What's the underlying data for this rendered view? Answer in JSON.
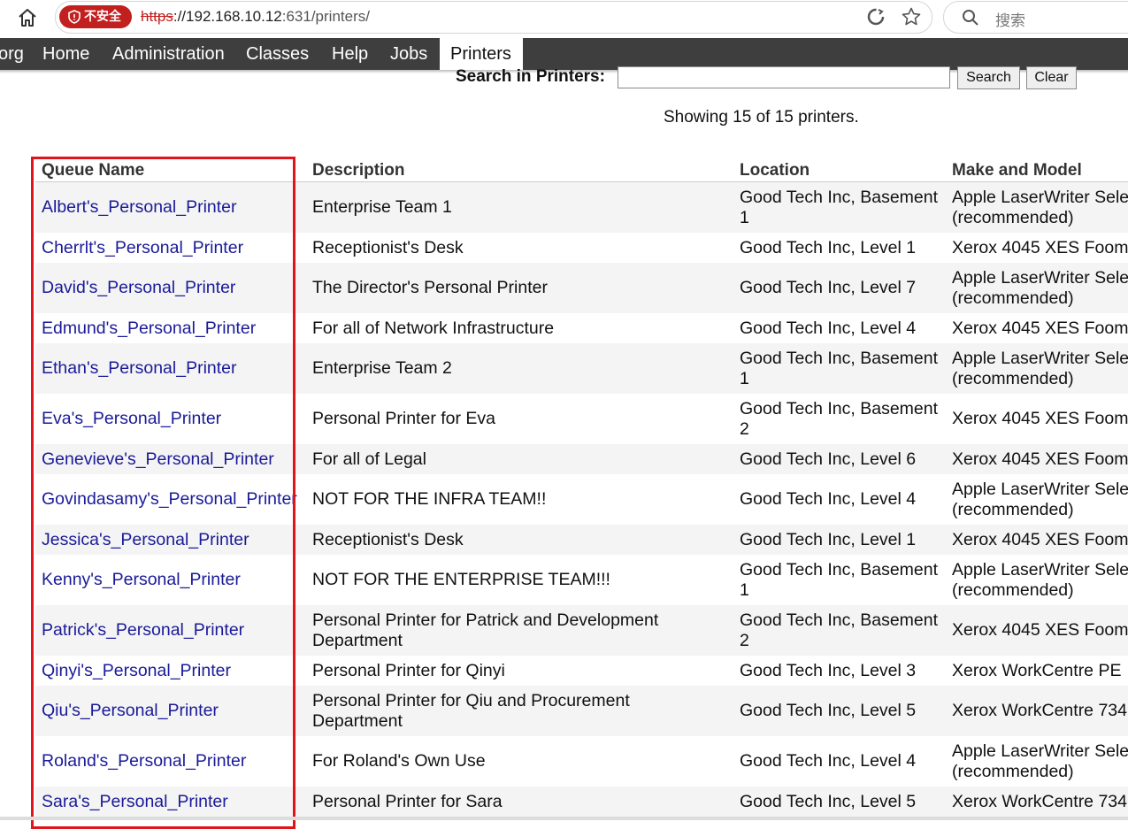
{
  "browser": {
    "security_label": "不安全",
    "url_scheme": "https",
    "url_host": "://192.168.10.12",
    "url_path": ":631/printers/",
    "search_placeholder": "搜索"
  },
  "nav": {
    "partial": "org",
    "items": [
      "Home",
      "Administration",
      "Classes",
      "Help",
      "Jobs",
      "Printers"
    ],
    "active": "Printers"
  },
  "search": {
    "label": "Search in Printers:",
    "value": "",
    "search_button": "Search",
    "clear_button": "Clear"
  },
  "showing_text": "Showing 15 of 15 printers.",
  "table": {
    "headers": [
      "Queue Name",
      "Description",
      "Location",
      "Make and Model"
    ],
    "rows": [
      {
        "queue": "Albert's_Personal_Printer",
        "description": [
          "Enterprise Team 1"
        ],
        "location": [
          "Good Tech Inc, Basement",
          "1"
        ],
        "model": [
          "Apple LaserWriter Sele",
          "(recommended)"
        ]
      },
      {
        "queue": "Cherrlt's_Personal_Printer",
        "description": [
          "Receptionist's Desk"
        ],
        "location": [
          "Good Tech Inc, Level 1"
        ],
        "model": [
          "Xerox 4045 XES Foom"
        ]
      },
      {
        "queue": "David's_Personal_Printer",
        "description": [
          "The Director's Personal Printer"
        ],
        "location": [
          "Good Tech Inc, Level 7"
        ],
        "model": [
          "Apple LaserWriter Sele",
          "(recommended)"
        ]
      },
      {
        "queue": "Edmund's_Personal_Printer",
        "description": [
          "For all of Network Infrastructure"
        ],
        "location": [
          "Good Tech Inc, Level 4"
        ],
        "model": [
          "Xerox 4045 XES Foom"
        ]
      },
      {
        "queue": "Ethan's_Personal_Printer",
        "description": [
          "Enterprise Team 2"
        ],
        "location": [
          "Good Tech Inc, Basement",
          "1"
        ],
        "model": [
          "Apple LaserWriter Sele",
          "(recommended)"
        ]
      },
      {
        "queue": "Eva's_Personal_Printer",
        "description": [
          "Personal Printer for Eva"
        ],
        "location": [
          "Good Tech Inc, Basement",
          "2"
        ],
        "model": [
          "Xerox 4045 XES Foom"
        ]
      },
      {
        "queue": "Genevieve's_Personal_Printer",
        "description": [
          "For all of Legal"
        ],
        "location": [
          "Good Tech Inc, Level 6"
        ],
        "model": [
          "Xerox 4045 XES Foom"
        ]
      },
      {
        "queue": "Govindasamy's_Personal_Printer",
        "description": [
          "NOT FOR THE INFRA TEAM!!"
        ],
        "location": [
          "Good Tech Inc, Level 4"
        ],
        "model": [
          "Apple LaserWriter Sele",
          "(recommended)"
        ]
      },
      {
        "queue": "Jessica's_Personal_Printer",
        "description": [
          "Receptionist's Desk"
        ],
        "location": [
          "Good Tech Inc, Level 1"
        ],
        "model": [
          "Xerox 4045 XES Foom"
        ]
      },
      {
        "queue": "Kenny's_Personal_Printer",
        "description": [
          "NOT FOR THE ENTERPRISE TEAM!!!"
        ],
        "location": [
          "Good Tech Inc, Basement",
          "1"
        ],
        "model": [
          "Apple LaserWriter Sele",
          "(recommended)"
        ]
      },
      {
        "queue": "Patrick's_Personal_Printer",
        "description": [
          "Personal Printer for Patrick and Development",
          "Department"
        ],
        "location": [
          "Good Tech Inc, Basement",
          "2"
        ],
        "model": [
          "Xerox 4045 XES Foom"
        ]
      },
      {
        "queue": "Qinyi's_Personal_Printer",
        "description": [
          "Personal Printer for Qinyi"
        ],
        "location": [
          "Good Tech Inc, Level 3"
        ],
        "model": [
          "Xerox WorkCentre PE"
        ]
      },
      {
        "queue": "Qiu's_Personal_Printer",
        "description": [
          "Personal Printer for Qiu and Procurement",
          "Department"
        ],
        "location": [
          "Good Tech Inc, Level 5"
        ],
        "model": [
          "Xerox WorkCentre 734"
        ]
      },
      {
        "queue": "Roland's_Personal_Printer",
        "description": [
          "For Roland's Own Use"
        ],
        "location": [
          "Good Tech Inc, Level 4"
        ],
        "model": [
          "Apple LaserWriter Sele",
          "(recommended)"
        ]
      },
      {
        "queue": "Sara's_Personal_Printer",
        "description": [
          "Personal Printer for Sara"
        ],
        "location": [
          "Good Tech Inc, Level 5"
        ],
        "model": [
          "Xerox WorkCentre 734"
        ]
      }
    ]
  },
  "colors": {
    "nav_bg": "#3e3e3e",
    "link": "#1a1a99",
    "highlight": "#e0141b",
    "insecure_badge": "#c21f1f"
  }
}
